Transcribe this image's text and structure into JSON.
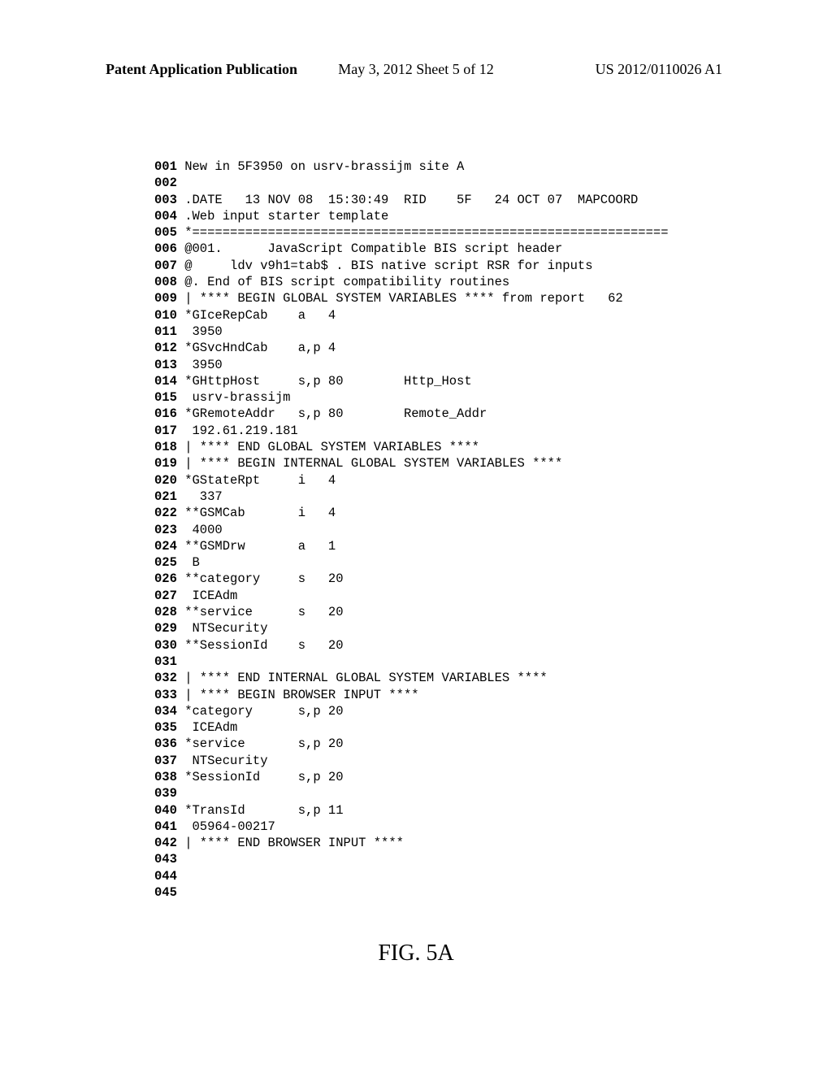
{
  "header": {
    "left": "Patent Application Publication",
    "center": "May 3, 2012  Sheet 5 of 12",
    "right": "US 2012/0110026 A1"
  },
  "code": {
    "lines": [
      {
        "num": "001",
        "text": " New in 5F3950 on usrv-brassijm site A"
      },
      {
        "num": "002",
        "text": ""
      },
      {
        "num": "003",
        "text": " .DATE   13 NOV 08  15:30:49  RID    5F   24 OCT 07  MAPCOORD"
      },
      {
        "num": "004",
        "text": " .Web input starter template"
      },
      {
        "num": "005",
        "text": " *==============================================================="
      },
      {
        "num": "006",
        "text": " @001.      JavaScript Compatible BIS script header"
      },
      {
        "num": "007",
        "text": " @     ldv v9h1=tab$ . BIS native script RSR for inputs"
      },
      {
        "num": "008",
        "text": " @. End of BIS script compatibility routines"
      },
      {
        "num": "009",
        "text": " | **** BEGIN GLOBAL SYSTEM VARIABLES **** from report   62"
      },
      {
        "num": "010",
        "text": " *GIceRepCab    a   4"
      },
      {
        "num": "011",
        "text": "  3950"
      },
      {
        "num": "012",
        "text": " *GSvcHndCab    a,p 4"
      },
      {
        "num": "013",
        "text": "  3950"
      },
      {
        "num": "014",
        "text": " *GHttpHost     s,p 80        Http_Host"
      },
      {
        "num": "015",
        "text": "  usrv-brassijm"
      },
      {
        "num": "016",
        "text": " *GRemoteAddr   s,p 80        Remote_Addr"
      },
      {
        "num": "017",
        "text": "  192.61.219.181"
      },
      {
        "num": "018",
        "text": " | **** END GLOBAL SYSTEM VARIABLES ****"
      },
      {
        "num": "019",
        "text": " | **** BEGIN INTERNAL GLOBAL SYSTEM VARIABLES ****"
      },
      {
        "num": "020",
        "text": " *GStateRpt     i   4"
      },
      {
        "num": "021",
        "text": "   337"
      },
      {
        "num": "022",
        "text": " **GSMCab       i   4"
      },
      {
        "num": "023",
        "text": "  4000"
      },
      {
        "num": "024",
        "text": " **GSMDrw       a   1"
      },
      {
        "num": "025",
        "text": "  B"
      },
      {
        "num": "026",
        "text": " **category     s   20"
      },
      {
        "num": "027",
        "text": "  ICEAdm"
      },
      {
        "num": "028",
        "text": " **service      s   20"
      },
      {
        "num": "029",
        "text": "  NTSecurity"
      },
      {
        "num": "030",
        "text": " **SessionId    s   20"
      },
      {
        "num": "031",
        "text": ""
      },
      {
        "num": "032",
        "text": " | **** END INTERNAL GLOBAL SYSTEM VARIABLES ****"
      },
      {
        "num": "033",
        "text": " | **** BEGIN BROWSER INPUT ****"
      },
      {
        "num": "034",
        "text": " *category      s,p 20"
      },
      {
        "num": "035",
        "text": "  ICEAdm"
      },
      {
        "num": "036",
        "text": " *service       s,p 20"
      },
      {
        "num": "037",
        "text": "  NTSecurity"
      },
      {
        "num": "038",
        "text": " *SessionId     s,p 20"
      },
      {
        "num": "039",
        "text": ""
      },
      {
        "num": "040",
        "text": " *TransId       s,p 11"
      },
      {
        "num": "041",
        "text": "  05964-00217"
      },
      {
        "num": "042",
        "text": " | **** END BROWSER INPUT ****"
      },
      {
        "num": "043",
        "text": ""
      },
      {
        "num": "044",
        "text": ""
      },
      {
        "num": "045",
        "text": ""
      }
    ]
  },
  "figure": {
    "label": "FIG. 5A"
  }
}
